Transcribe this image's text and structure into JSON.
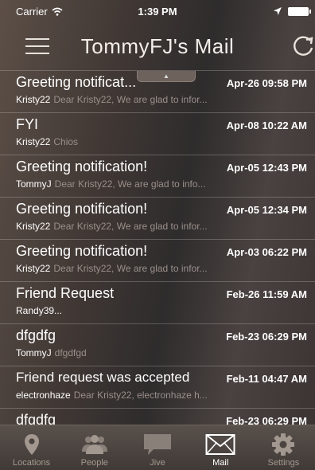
{
  "status_bar": {
    "carrier": "Carrier",
    "time": "1:39 PM"
  },
  "nav": {
    "title": "TommyFJ's Mail"
  },
  "messages": [
    {
      "subject": "Greeting notificat...",
      "date": "Apr-26 09:58 PM",
      "sender": "Kristy22",
      "preview": "Dear Kristy22,  We are glad to infor..."
    },
    {
      "subject": "FYI",
      "date": "Apr-08 10:22 AM",
      "sender": "Kristy22",
      "preview": "Chios"
    },
    {
      "subject": "Greeting notification!",
      "date": "Apr-05 12:43 PM",
      "sender": "TommyJ",
      "preview": "Dear Kristy22,  We are glad to info..."
    },
    {
      "subject": "Greeting notification!",
      "date": "Apr-05 12:34 PM",
      "sender": "Kristy22",
      "preview": "Dear Kristy22,  We are glad to infor..."
    },
    {
      "subject": "Greeting notification!",
      "date": "Apr-03 06:22 PM",
      "sender": "Kristy22",
      "preview": "Dear Kristy22,  We are glad to infor..."
    },
    {
      "subject": "Friend Request",
      "date": "Feb-26 11:59 AM",
      "sender": "Randy39...",
      "preview": ""
    },
    {
      "subject": "dfgdfg",
      "date": "Feb-23 06:29 PM",
      "sender": "TommyJ",
      "preview": "dfgdfgd"
    },
    {
      "subject": "Friend request was accepted",
      "date": "Feb-11 04:47 AM",
      "sender": "electronhaze",
      "preview": "Dear Kristy22, electronhaze h..."
    },
    {
      "subject": "dfgdfg",
      "date": "Feb-23 06:29 PM",
      "sender": "",
      "preview": ""
    }
  ],
  "tabs": [
    {
      "label": "Locations",
      "icon": "location-pin-icon",
      "active": false
    },
    {
      "label": "People",
      "icon": "people-icon",
      "active": false
    },
    {
      "label": "Jive",
      "icon": "chat-bubble-icon",
      "active": false
    },
    {
      "label": "Mail",
      "icon": "envelope-icon",
      "active": true
    },
    {
      "label": "Settings",
      "icon": "gear-icon",
      "active": false
    }
  ],
  "colors": {
    "tab_inactive": "#a39890",
    "tab_active": "#ffffff",
    "preview_text": "#9a8f8a"
  }
}
